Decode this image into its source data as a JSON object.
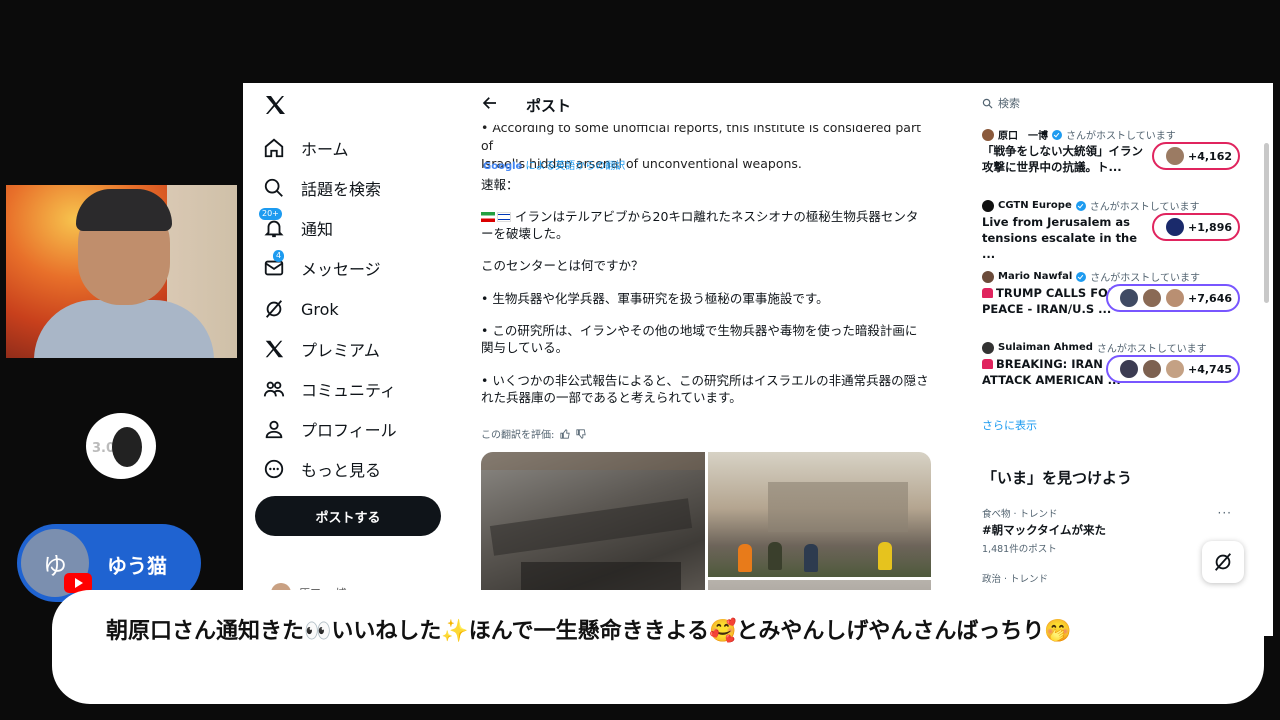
{
  "nav": {
    "items": [
      {
        "label": "ホーム",
        "icon": "home-icon"
      },
      {
        "label": "話題を検索",
        "icon": "search-icon"
      },
      {
        "label": "通知",
        "icon": "bell-icon",
        "badge": "20+"
      },
      {
        "label": "メッセージ",
        "icon": "mail-icon",
        "badge": "4"
      },
      {
        "label": "Grok",
        "icon": "grok-icon"
      },
      {
        "label": "プレミアム",
        "icon": "x-icon"
      },
      {
        "label": "コミュニティ",
        "icon": "community-icon"
      },
      {
        "label": "プロフィール",
        "icon": "profile-icon"
      },
      {
        "label": "もっと見る",
        "icon": "more-icon"
      }
    ],
    "post_button": "ポストする",
    "profile_name": "原口 一博"
  },
  "post": {
    "header_title": "ポスト",
    "english_lines": [
      "• According to some unofficial reports, this institute is considered part of",
      "Israel's hidden arsenal of unconventional weapons."
    ],
    "google_label": "Google",
    "translation_credit": "による英語からの翻訳",
    "breaking": "速報：",
    "p1": "イランはテルアビブから20キロ離れたネスシオナの極秘生物兵器センターを破壊した。",
    "p2": "このセンターとは何ですか？",
    "p3": "• 生物兵器や化学兵器、軍事研究を扱う極秘の軍事施設です。",
    "p4": "• この研究所は、イランやその他の地域で生物兵器や毒物を使った暗殺計画に関与している。",
    "p5": "• いくつかの非公式報告によると、この研究所はイスラエルの非通常兵器の隠された兵器庫の一部であると考えられています。",
    "rate_label": "この翻訳を評価:"
  },
  "right": {
    "search_placeholder": "検索",
    "spaces": [
      {
        "host": "原口　一博",
        "host_suffix": "さんがホストしています",
        "title": "「戦争をしない大統領」イラン攻撃に世界中の抗議。ト...",
        "count": "+4,162",
        "color": "#e0245e"
      },
      {
        "host": "CGTN Europe",
        "host_suffix": "さんがホストしています",
        "title": "Live from Jerusalem as tensions escalate in the ...",
        "count": "+1,896",
        "color": "#e0245e"
      },
      {
        "host": "Mario Nawfal",
        "host_suffix": "さんがホストしています",
        "title": "TRUMP CALLS FOR PEACE - IRAN/U.S ...",
        "count": "+7,646",
        "color": "#7856ff"
      },
      {
        "host": "Sulaiman Ahmed",
        "host_suffix": "さんがホストしています",
        "title": "BREAKING: IRAN ATTACK AMERICAN ...",
        "count": "+4,745",
        "color": "#7856ff"
      }
    ],
    "show_more": "さらに表示",
    "trends_heading": "「いま」を見つけよう",
    "trends": [
      {
        "category": "食べ物 · トレンド",
        "name": "#朝マックタイムが来た",
        "count": "1,481件のポスト"
      },
      {
        "category": "政治 · トレンド",
        "name": "",
        "count": ""
      }
    ]
  },
  "stream": {
    "badge_text": "3.0",
    "user_initial": "ゆ",
    "user_name": "ゆう猫",
    "chat_message": "朝原口さん通知きた👀いいねした✨ほんで一生懸命ききよる🥰とみやんしげやんさんばっちり🤭"
  }
}
